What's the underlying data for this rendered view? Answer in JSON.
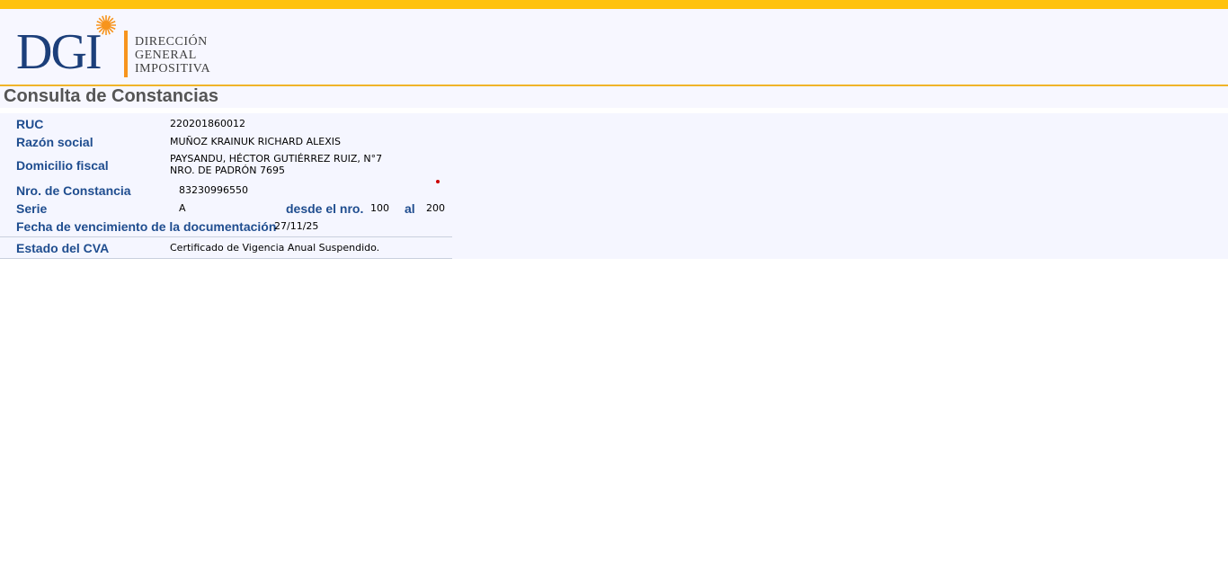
{
  "header": {
    "logo": {
      "acronym": "DGI",
      "line1": "Dirección",
      "line2": "General",
      "line3": "Impositiva"
    }
  },
  "page": {
    "title": "Consulta de Constancias"
  },
  "fields": {
    "ruc": {
      "label": "RUC",
      "value": "220201860012"
    },
    "razon_social": {
      "label": "Razón social",
      "value": "MUÑOZ KRAINUK RICHARD ALEXIS"
    },
    "domicilio_fiscal": {
      "label": "Domicilio fiscal",
      "line1": "PAYSANDU, HÉCTOR GUTIÉRREZ RUIZ, N°7",
      "line2": "NRO. DE PADRÓN 7695"
    },
    "nro_constancia": {
      "label": "Nro. de Constancia",
      "value": "83230996550"
    },
    "serie": {
      "label": "Serie",
      "value": "A",
      "desde_label": "desde el nro.",
      "desde_value": "100",
      "al_label": "al",
      "al_value": "200"
    },
    "vencimiento": {
      "label": "Fecha de vencimiento de la documentación",
      "value": "27/11/25"
    },
    "estado_cva": {
      "label": "Estado del CVA",
      "value": "Certificado de Vigencia Anual Suspendido."
    }
  },
  "colors": {
    "top_bar": "#ffc20e",
    "label_blue": "#1f4d8f",
    "logo_blue": "#1c3f7a",
    "logo_orange": "#f7941d"
  }
}
